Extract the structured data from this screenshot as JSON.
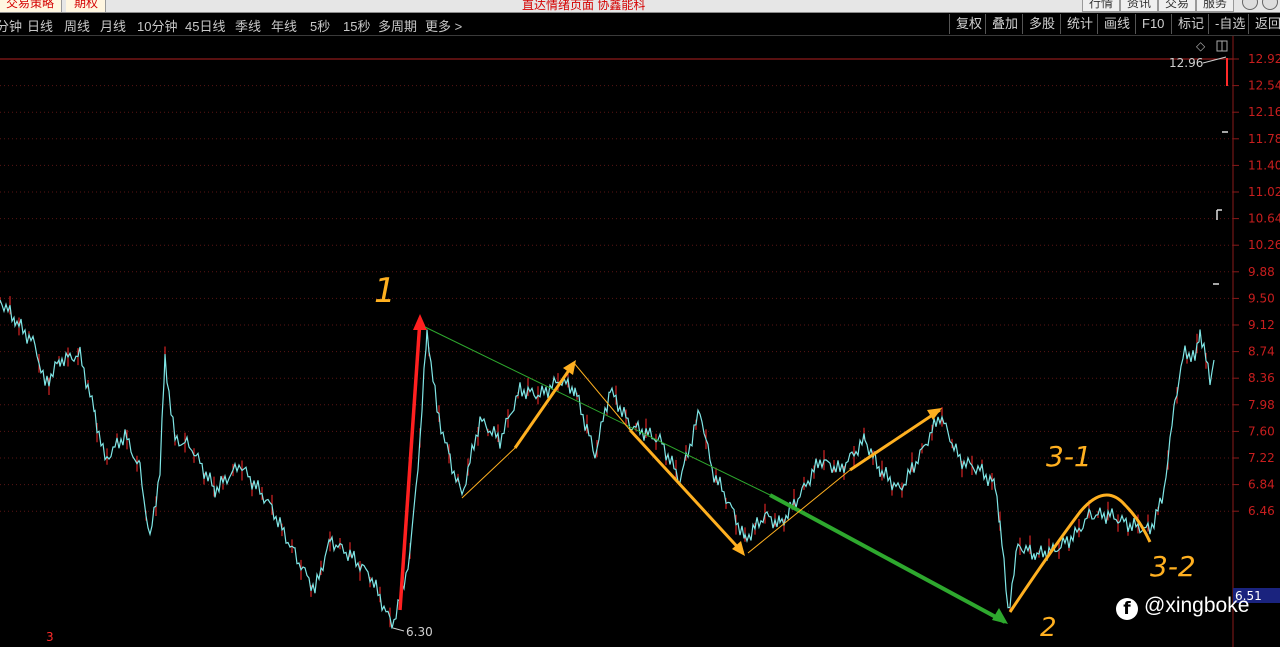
{
  "top": {
    "tab_strategy": "交易策略",
    "tab_option": "期权",
    "ticker": "直达情绪页面  协鑫能科",
    "buttons": [
      "行情",
      "资讯",
      "交易",
      "服务"
    ]
  },
  "toolbar": {
    "periods": [
      "分钟",
      "日线",
      "周线",
      "月线",
      "10分钟",
      "45日线",
      "季线",
      "年线",
      "5秒",
      "15秒",
      "多周期",
      "更多 >"
    ],
    "right_buttons": [
      "复权",
      "叠加",
      "多股",
      "统计",
      "画线",
      "F10",
      "标记",
      "-自选",
      "返回"
    ]
  },
  "y_axis": {
    "labels": [
      "12.92",
      "12.54",
      "12.16",
      "11.78",
      "11.40",
      "11.02",
      "10.64",
      "10.26",
      "9.88",
      "9.50",
      "9.12",
      "8.74",
      "8.36",
      "7.98",
      "7.60",
      "7.22",
      "6.84",
      "6.46"
    ],
    "current_price": "6.51",
    "scale_icon": "diamond-icon",
    "layout_icon": "split-panel-icon"
  },
  "chart_labels": {
    "high_label": "12.96",
    "low_label": "6.30",
    "bottom_marker": "3"
  },
  "annotations": {
    "mark_1": "1",
    "mark_2": "2",
    "mark_3_1": "3-1",
    "mark_3_2": "3-2"
  },
  "watermark": {
    "icon": "facebook-icon",
    "text": "@xingboke"
  },
  "colors": {
    "background": "#000000",
    "price_line": "#7fe6e6",
    "candle_up": "#ff2a2a",
    "grid": "#8a1a1a",
    "axis_text": "#c81e1e",
    "annotation_red": "#ff2020",
    "annotation_orange": "#ffb020",
    "annotation_green": "#2ea82e",
    "current_price_badge": "#1a237e"
  }
}
